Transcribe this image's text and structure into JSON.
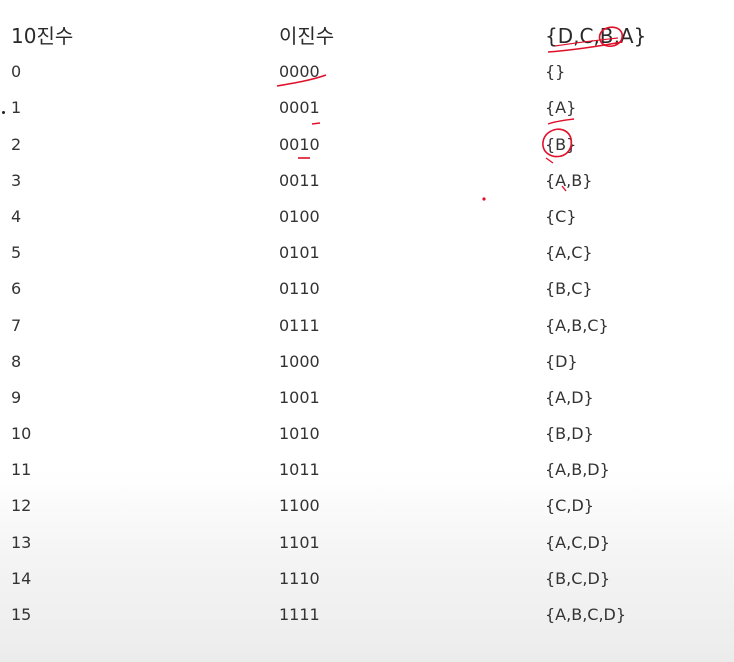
{
  "table": {
    "headers": [
      "10진수",
      "이진수",
      "{D,C,B,A}"
    ],
    "rows": [
      [
        "0",
        "0000",
        "{}"
      ],
      [
        "1",
        "0001",
        "{A}"
      ],
      [
        "2",
        "0010",
        "{B}"
      ],
      [
        "3",
        "0011",
        "{A,B}"
      ],
      [
        "4",
        "0100",
        "{C}"
      ],
      [
        "5",
        "0101",
        "{A,C}"
      ],
      [
        "6",
        "0110",
        "{B,C}"
      ],
      [
        "7",
        "0111",
        "{A,B,C}"
      ],
      [
        "8",
        "1000",
        "{D}"
      ],
      [
        "9",
        "1001",
        "{A,D}"
      ],
      [
        "10",
        "1010",
        "{B,D}"
      ],
      [
        "11",
        "1011",
        "{A,B,D}"
      ],
      [
        "12",
        "1100",
        "{C,D}"
      ],
      [
        "13",
        "1101",
        "{A,C,D}"
      ],
      [
        "14",
        "1110",
        "{B,C,D}"
      ],
      [
        "15",
        "1111",
        "{A,B,C,D}"
      ]
    ]
  },
  "colors": {
    "text": "#333333",
    "annotation": "#e0102a"
  }
}
